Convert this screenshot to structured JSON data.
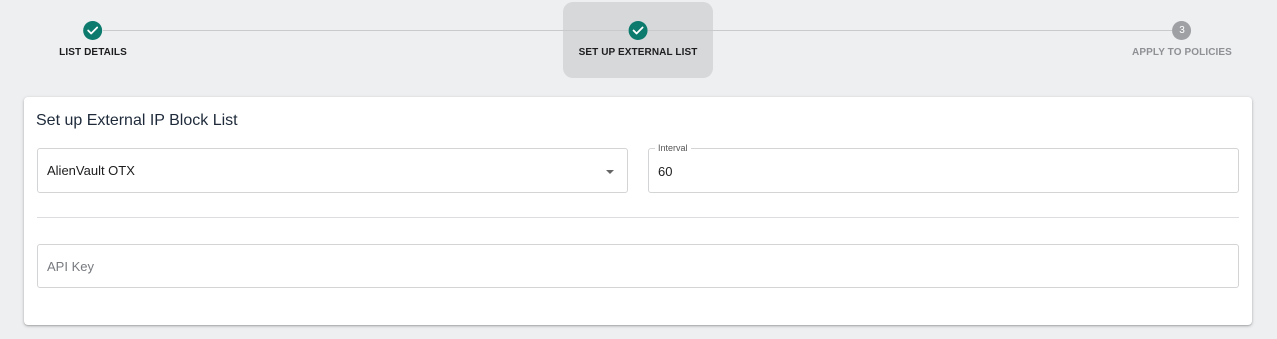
{
  "stepper": {
    "steps": [
      {
        "label": "LIST DETAILS",
        "status": "complete",
        "marker": "✓"
      },
      {
        "label": "SET UP EXTERNAL LIST",
        "status": "complete",
        "marker": "✓"
      },
      {
        "label": "APPLY TO POLICIES",
        "status": "pending",
        "marker": "3"
      }
    ],
    "active_step": 2
  },
  "card": {
    "title": "Set up External IP Block List",
    "source_select": {
      "value": "AlienVault OTX"
    },
    "interval": {
      "label": "Interval",
      "value": "60"
    },
    "api_key": {
      "placeholder": "API Key",
      "value": ""
    }
  },
  "colors": {
    "complete": "#0d7a6e",
    "pending": "#9ea0a4",
    "active_highlight": "#d7d8da",
    "page_background": "#eeeff1"
  }
}
